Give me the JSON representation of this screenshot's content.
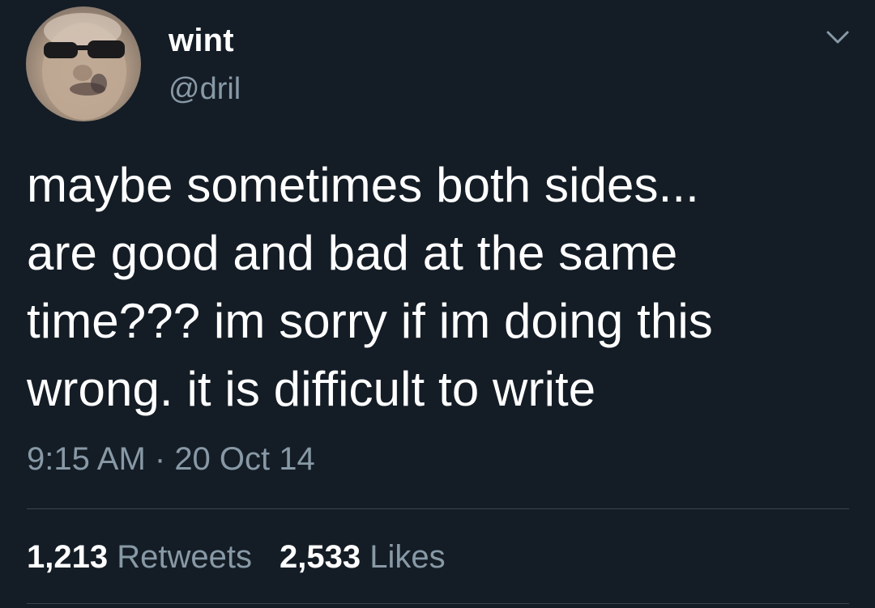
{
  "user": {
    "display_name": "wint",
    "handle": "@dril",
    "avatar_icon": "profile-photo"
  },
  "menu_icon": "chevron-down-icon",
  "tweet": {
    "text": "maybe sometimes both sides...\nare good and bad at the same\ntime??? im sorry if im doing this\nwrong. it is difficult to write",
    "time": "9:15 AM",
    "separator": " · ",
    "date": "20 Oct 14"
  },
  "stats": {
    "retweets_count": "1,213",
    "retweets_label": "Retweets",
    "likes_count": "2,533",
    "likes_label": "Likes"
  },
  "colors": {
    "background": "#141d26",
    "text_primary": "#ffffff",
    "text_secondary": "#8899a6",
    "divider": "#38444d"
  }
}
